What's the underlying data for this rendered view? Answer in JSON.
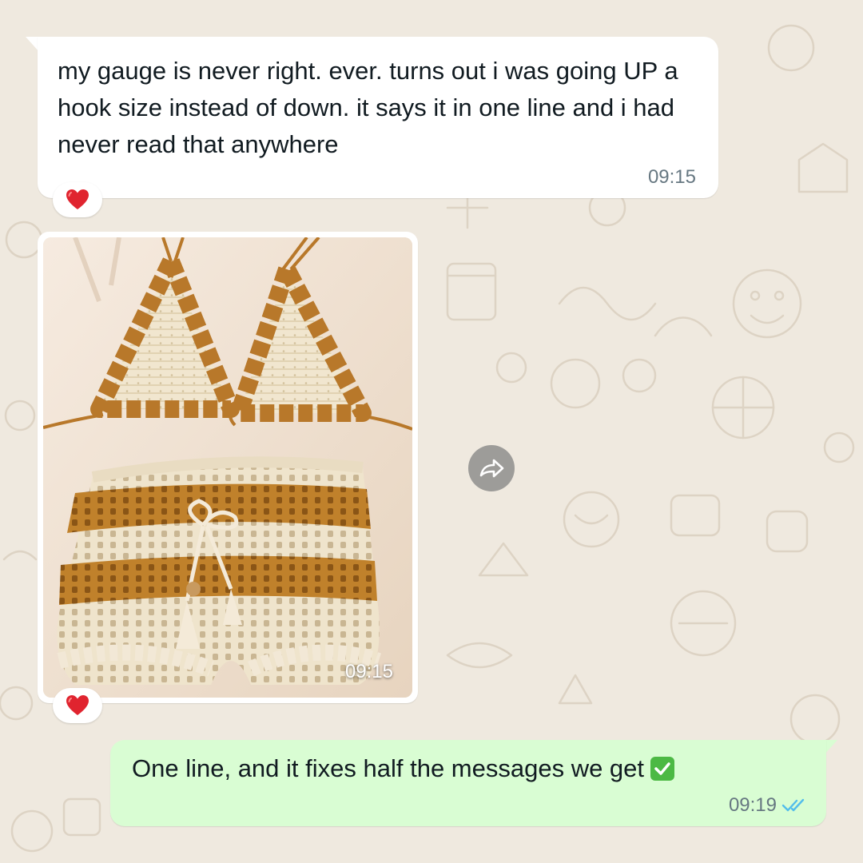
{
  "messages": {
    "incoming_text": {
      "text": "my gauge is never right. ever. turns out i was going UP a hook size instead of down. it says it in one line and i had never read that anywhere",
      "time": "09:15",
      "reaction": "heart-emoji"
    },
    "incoming_image": {
      "time": "09:15",
      "reaction": "heart-emoji"
    },
    "outgoing_text": {
      "text": "One line, and it fixes half the messages we get",
      "emoji": "check-mark-button-emoji",
      "time": "09:19",
      "status": "read-double-check-icon"
    }
  },
  "icons": {
    "forward": "forward-icon"
  },
  "colors": {
    "wallpaper": "#efe9df",
    "incoming_bubble": "#ffffff",
    "outgoing_bubble": "#d9fdd3",
    "timestamp": "#667781",
    "read_ticks": "#53bdeb",
    "heart": "#e0242f",
    "check_emoji": "#4cb944"
  }
}
